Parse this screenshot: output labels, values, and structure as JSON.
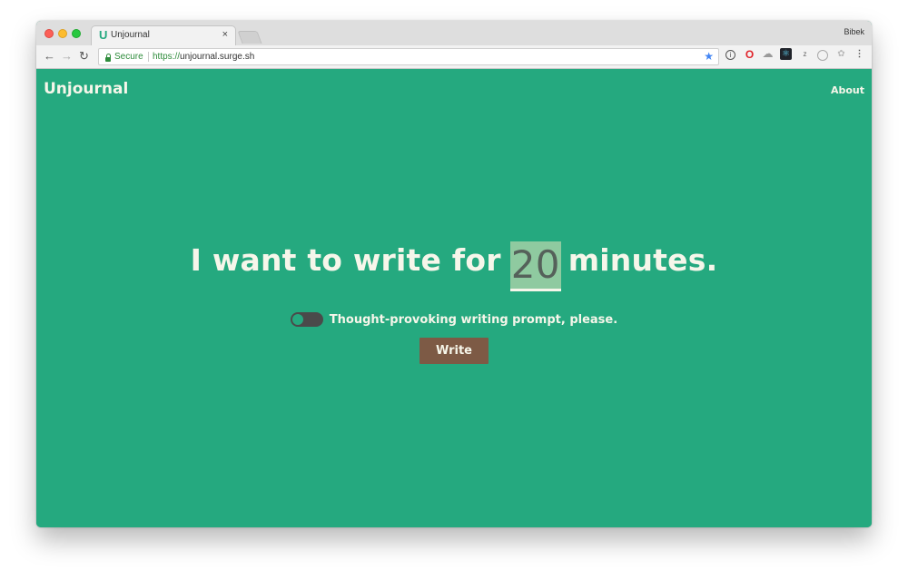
{
  "browser": {
    "tab_title": "Unjournal",
    "tab_close": "×",
    "profile_name": "Bibek",
    "security_label": "Secure",
    "url_scheme": "https://",
    "url_host": "unjournal.surge.sh",
    "nav": {
      "back": "←",
      "forward": "→",
      "reload": "↻"
    },
    "bookmark_star": "★",
    "extensions": [
      "info-icon",
      "opera-icon",
      "cloud-icon",
      "react-devtools-icon",
      "z-icon",
      "circle-icon",
      "grey-extension-icon",
      "menu-icon"
    ]
  },
  "app": {
    "brand": "Unjournal",
    "nav_about": "About",
    "headline_prefix": "I want to write for",
    "minutes_value": "20",
    "headline_suffix": "minutes.",
    "prompt_toggle_label": "Thought-provoking writing prompt, please.",
    "write_button": "Write"
  },
  "colors": {
    "background": "#25a97f",
    "text": "#f6f6ea",
    "button": "#7d5a45",
    "input_bg": "#8fcaa0",
    "toggle": "#4a4a4a"
  }
}
